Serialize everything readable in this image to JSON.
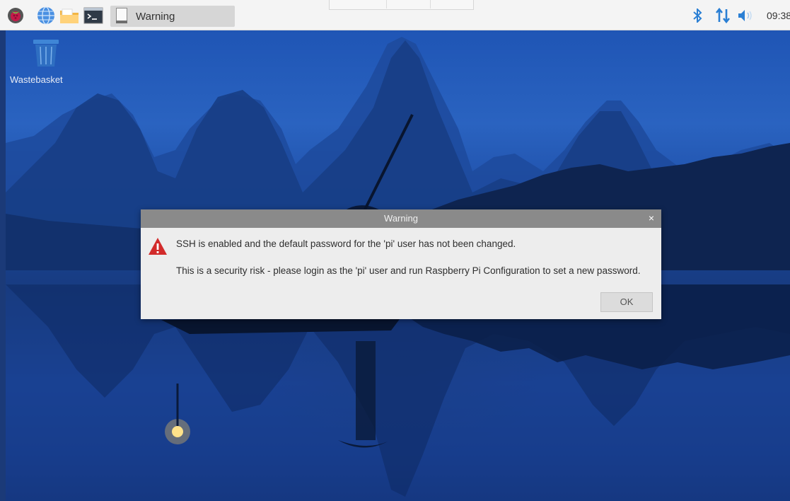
{
  "taskbar": {
    "task_button_label": "Warning",
    "clock": "09:38",
    "icons": [
      "raspberry-menu-icon",
      "web-browser-icon",
      "file-manager-icon",
      "terminal-icon"
    ],
    "tray_icons": [
      "bluetooth-icon",
      "network-icon",
      "volume-icon"
    ]
  },
  "desktop": {
    "icons": [
      {
        "label": "Wastebasket",
        "icon": "wastebasket-icon"
      }
    ]
  },
  "dialog": {
    "title": "Warning",
    "close_label": "×",
    "message_line1": "SSH is enabled and the default password for the 'pi' user has not been changed.",
    "message_line2": "This is a security risk - please login as the 'pi' user and run Raspberry Pi Configuration to set a new password.",
    "ok_label": "OK"
  },
  "colors": {
    "taskbar": "#f4f4f4",
    "dialog_titlebar": "#8a8a8a",
    "dialog_body": "#ededed",
    "warning_red": "#d22b2b",
    "bluetooth_blue": "#2a7fd4"
  }
}
